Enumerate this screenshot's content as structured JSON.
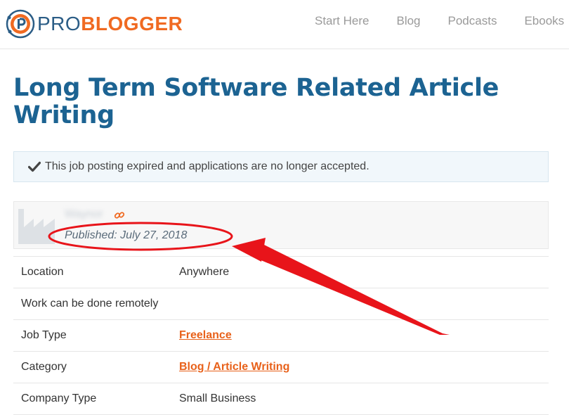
{
  "header": {
    "logo": {
      "pro": "PRO",
      "blogger": "BLOGGER"
    },
    "nav": [
      "Start Here",
      "Blog",
      "Podcasts",
      "Ebooks"
    ]
  },
  "job": {
    "title": "Long Term Software Related Article Writing",
    "notice": "This job posting expired and applications are no longer accepted.",
    "company": {
      "name": "Waynor",
      "published": "Published: July 27, 2018"
    },
    "details": [
      {
        "label": "Location",
        "value": "Anywhere",
        "link": false
      },
      {
        "label": "Work can be done remotely",
        "value": "",
        "link": false
      },
      {
        "label": "Job Type",
        "value": "Freelance",
        "link": true
      },
      {
        "label": "Category",
        "value": "Blog / Article Writing",
        "link": true
      },
      {
        "label": "Company Type",
        "value": "Small Business",
        "link": false
      }
    ]
  },
  "colors": {
    "brand_blue": "#1c6392",
    "brand_orange": "#f06a22",
    "link_orange": "#e8611a",
    "annotation_red": "#e8141a"
  }
}
